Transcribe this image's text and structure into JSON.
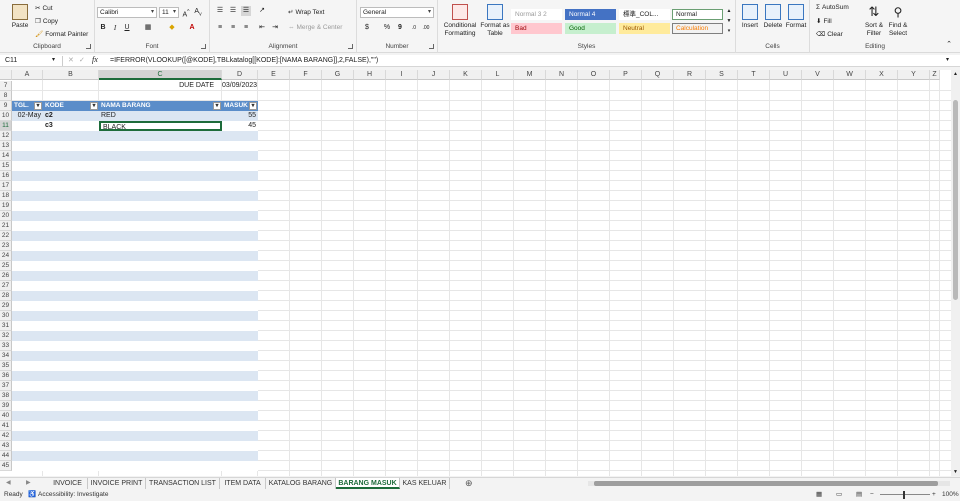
{
  "ribbon": {
    "clipboard": {
      "paste": "Paste",
      "cut": "Cut",
      "copy": "Copy",
      "format_painter": "Format Painter",
      "label": "Clipboard"
    },
    "font": {
      "name": "Calibri",
      "size": "11",
      "label": "Font"
    },
    "alignment": {
      "wrap_text": "Wrap Text",
      "merge_center": "Merge & Center",
      "label": "Alignment"
    },
    "number": {
      "format": "General",
      "label": "Number"
    },
    "styles": {
      "conditional": "Conditional Formatting",
      "format_table": "Format as Table",
      "cells": [
        {
          "text": "Normal 3 2",
          "bg": "#ffffff",
          "fg": "#9a9a9a"
        },
        {
          "text": "Normal 4",
          "bg": "#4472c4",
          "fg": "#ffffff"
        },
        {
          "text": "標準_COL...",
          "bg": "#ffffff",
          "fg": "#222222"
        },
        {
          "text": "Normal",
          "bg": "#ffffff",
          "fg": "#222222"
        },
        {
          "text": "Bad",
          "bg": "#ffc7ce",
          "fg": "#9c0006"
        },
        {
          "text": "Good",
          "bg": "#c6efce",
          "fg": "#006100"
        },
        {
          "text": "Neutral",
          "bg": "#ffeb9c",
          "fg": "#9c5700"
        },
        {
          "text": "Calculation",
          "bg": "#f2f2f2",
          "fg": "#fa7d00"
        }
      ],
      "label": "Styles"
    },
    "cells": {
      "insert": "Insert",
      "delete": "Delete",
      "format": "Format",
      "label": "Cells"
    },
    "editing": {
      "autosum": "AutoSum",
      "fill": "Fill",
      "clear": "Clear",
      "sort_filter": "Sort & Filter",
      "find_select": "Find & Select",
      "label": "Editing"
    }
  },
  "formula_bar": {
    "name_box": "C11",
    "formula": "=IFERROR(VLOOKUP([@KODE],TBLkatalog[[KODE]:[NAMA BARANG]],2,FALSE),\"\")"
  },
  "columns": [
    "A",
    "B",
    "C",
    "D",
    "E",
    "F",
    "G",
    "H",
    "I",
    "J",
    "K",
    "L",
    "M",
    "N",
    "O",
    "P",
    "Q",
    "R",
    "S",
    "T",
    "U",
    "V",
    "W",
    "X",
    "Y",
    "Z"
  ],
  "rows": [
    "7",
    "8",
    "9",
    "10",
    "11",
    "12",
    "13",
    "14",
    "15",
    "16",
    "17",
    "18",
    "19",
    "20",
    "21",
    "22",
    "23",
    "24",
    "25",
    "26",
    "27",
    "28",
    "29",
    "30",
    "31",
    "32",
    "33",
    "34",
    "35",
    "36",
    "37",
    "38",
    "39",
    "40",
    "41",
    "42",
    "43",
    "44",
    "45"
  ],
  "sheet": {
    "due_date_label": "DUE DATE",
    "due_date_value": "03/09/2023",
    "table_headers": [
      "TGL.",
      "KODE",
      "NAMA BARANG",
      "MASUK"
    ],
    "rows": [
      {
        "tgl": "02-May",
        "kode": "c2",
        "nama": "RED",
        "masuk": "55"
      },
      {
        "tgl": "",
        "kode": "c3",
        "nama": "BLACK",
        "masuk": "45"
      }
    ]
  },
  "tabs": [
    "INVOICE",
    "INVOICE PRINT",
    "TRANSACTION LIST",
    "ITEM DATA",
    "KATALOG BARANG",
    "BARANG MASUK",
    "KAS KELUAR"
  ],
  "active_tab": "BARANG MASUK",
  "status": {
    "ready": "Ready",
    "accessibility": "Accessibility: Investigate",
    "zoom": "100%"
  },
  "colors": {
    "table_header": "#5b8dc9",
    "band": "#dce6f2",
    "active_tab": "#1d6b3a"
  }
}
